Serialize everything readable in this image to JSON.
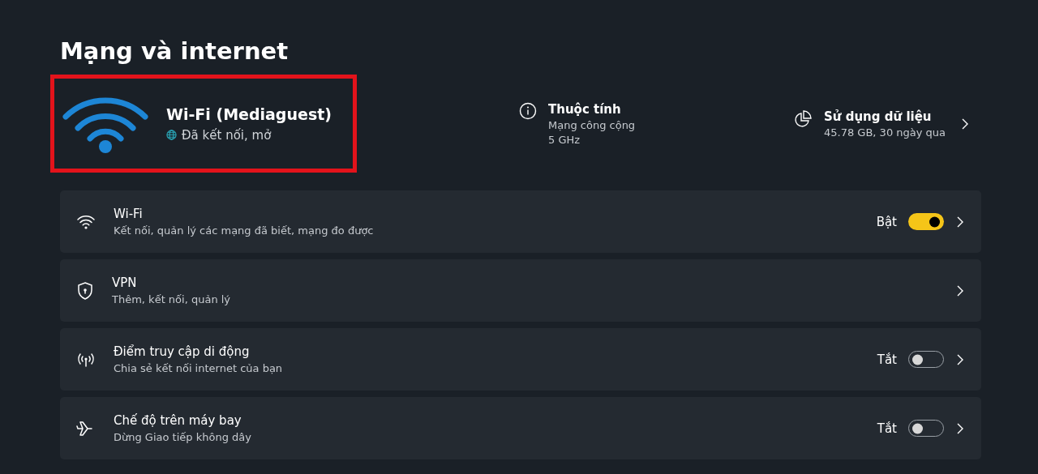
{
  "page_title": "Mạng và internet",
  "connection": {
    "name": "Wi-Fi (Mediaguest)",
    "status": "Đã kết nối, mở",
    "highlighted": true
  },
  "summary": [
    {
      "kind": "info",
      "title": "Thuộc tính",
      "lines": [
        "Mạng công cộng",
        "5 GHz"
      ]
    },
    {
      "kind": "usage",
      "title": "Sử dụng dữ liệu",
      "lines": [
        "45.78 GB, 30 ngày qua"
      ]
    }
  ],
  "settings": [
    {
      "kind": "wifi",
      "title": "Wi-Fi",
      "subtitle": "Kết nối, quản lý các mạng đã biết, mạng đo được",
      "state_label": "Bật",
      "on": true
    },
    {
      "kind": "vpn",
      "title": "VPN",
      "subtitle": "Thêm, kết nối, quản lý"
    },
    {
      "kind": "hotspot",
      "title": "Điểm truy cập di động",
      "subtitle": "Chia sẻ kết nối internet của bạn",
      "state_label": "Tắt",
      "on": false
    },
    {
      "kind": "airplane",
      "title": "Chế độ trên máy bay",
      "subtitle": "Dừng Giao tiếp không dây",
      "state_label": "Tắt",
      "on": false
    }
  ]
}
